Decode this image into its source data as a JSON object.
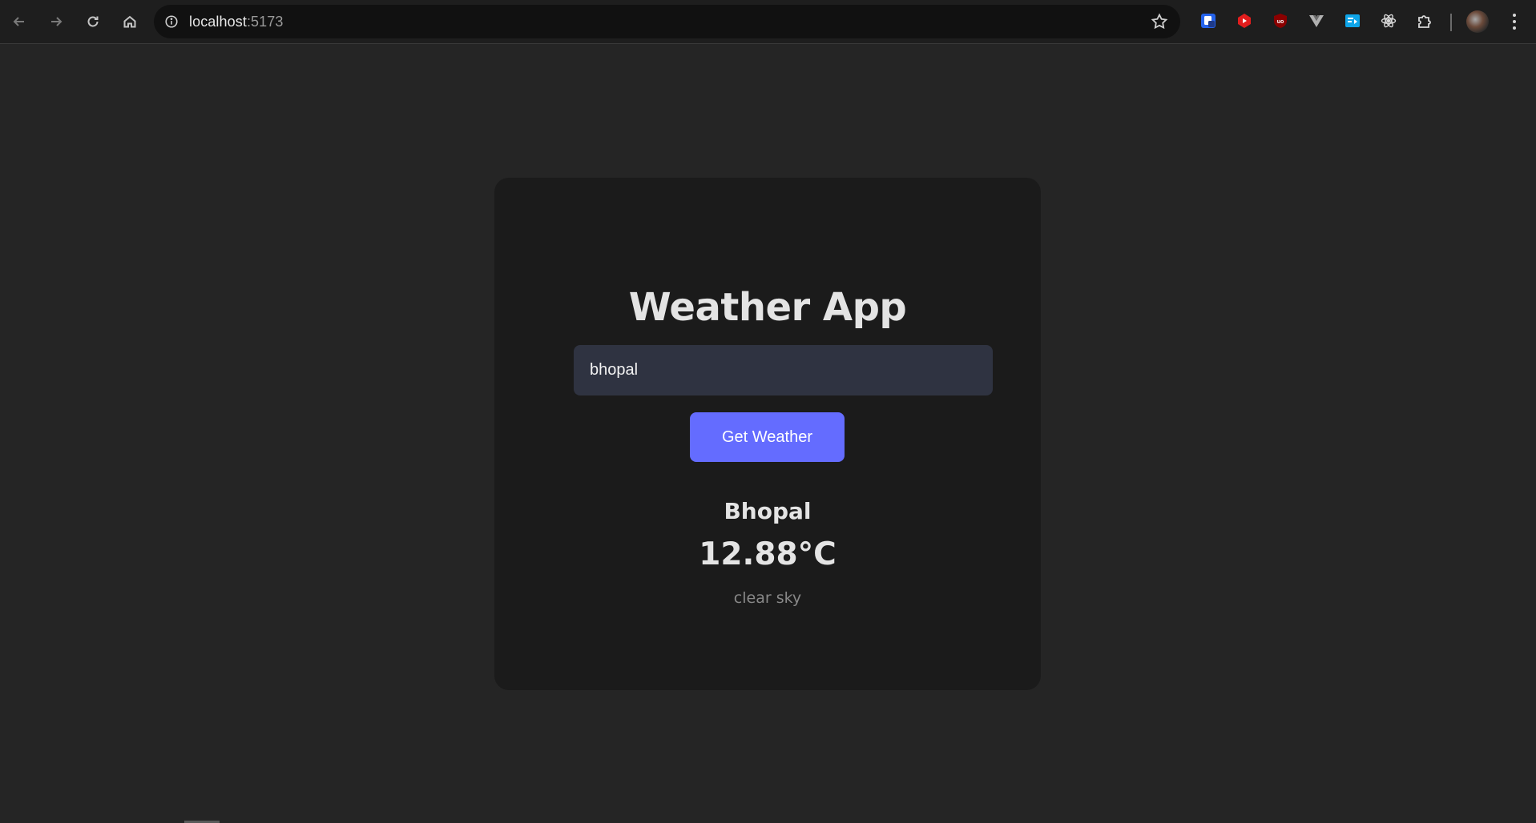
{
  "browser": {
    "url_host": "localhost",
    "url_port": ":5173",
    "icons": {
      "back": "back-arrow-icon",
      "forward": "forward-arrow-icon",
      "reload": "reload-icon",
      "home": "home-icon",
      "site_info": "info-icon",
      "bookmark": "star-icon",
      "extensions": [
        "shield-extension-icon",
        "youtube-extension-icon",
        "ublock-extension-icon",
        "vue-devtools-icon",
        "translate-extension-icon",
        "react-devtools-icon",
        "puzzle-extensions-icon"
      ],
      "profile": "avatar",
      "menu": "kebab-menu-icon"
    }
  },
  "app": {
    "title": "Weather App",
    "search": {
      "value": "bhopal",
      "placeholder": ""
    },
    "button_label": "Get Weather",
    "result": {
      "city": "Bhopal",
      "temperature": "12.88°C",
      "description": "clear sky"
    }
  },
  "colors": {
    "page_bg": "#252525",
    "card_bg": "#1b1b1b",
    "input_bg": "#2f3341",
    "accent": "#646cff",
    "text_primary": "#e4e4e4",
    "text_muted": "#888888"
  }
}
